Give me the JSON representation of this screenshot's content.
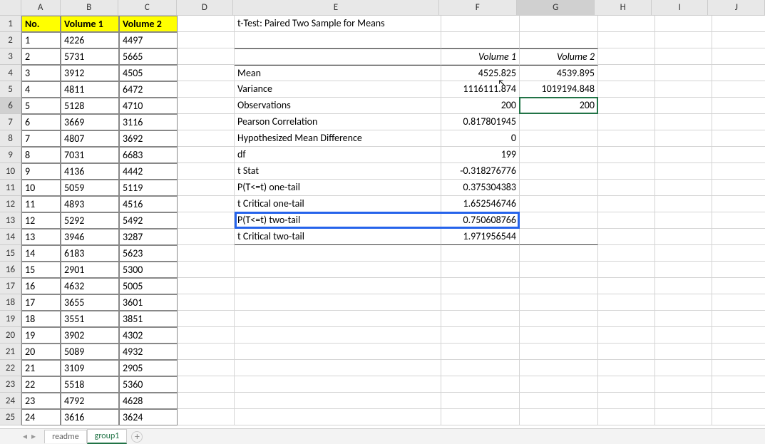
{
  "columns": [
    "A",
    "B",
    "C",
    "D",
    "E",
    "F",
    "G",
    "H",
    "I",
    "J"
  ],
  "selected_col": "G",
  "selected_row": 6,
  "data_headers": {
    "no": "No.",
    "v1": "Volume 1",
    "v2": "Volume 2"
  },
  "data_rows": [
    {
      "n": "1",
      "v1": "4226",
      "v2": "4497"
    },
    {
      "n": "2",
      "v1": "5731",
      "v2": "5665"
    },
    {
      "n": "3",
      "v1": "3912",
      "v2": "4505"
    },
    {
      "n": "4",
      "v1": "4811",
      "v2": "6472"
    },
    {
      "n": "5",
      "v1": "5128",
      "v2": "4710"
    },
    {
      "n": "6",
      "v1": "3669",
      "v2": "3116"
    },
    {
      "n": "7",
      "v1": "4807",
      "v2": "3692"
    },
    {
      "n": "8",
      "v1": "7031",
      "v2": "6683"
    },
    {
      "n": "9",
      "v1": "4136",
      "v2": "4442"
    },
    {
      "n": "10",
      "v1": "5059",
      "v2": "5119"
    },
    {
      "n": "11",
      "v1": "4893",
      "v2": "4516"
    },
    {
      "n": "12",
      "v1": "5292",
      "v2": "5492"
    },
    {
      "n": "13",
      "v1": "3946",
      "v2": "3287"
    },
    {
      "n": "14",
      "v1": "6183",
      "v2": "5623"
    },
    {
      "n": "15",
      "v1": "2901",
      "v2": "5300"
    },
    {
      "n": "16",
      "v1": "4632",
      "v2": "5005"
    },
    {
      "n": "17",
      "v1": "3655",
      "v2": "3601"
    },
    {
      "n": "18",
      "v1": "3551",
      "v2": "3851"
    },
    {
      "n": "19",
      "v1": "3902",
      "v2": "4302"
    },
    {
      "n": "20",
      "v1": "5089",
      "v2": "4932"
    },
    {
      "n": "21",
      "v1": "3109",
      "v2": "2905"
    },
    {
      "n": "22",
      "v1": "5518",
      "v2": "5360"
    },
    {
      "n": "23",
      "v1": "4792",
      "v2": "4628"
    },
    {
      "n": "24",
      "v1": "3616",
      "v2": "3624"
    }
  ],
  "ttest_title": "t-Test: Paired Two Sample for Means",
  "stat_header_v1": "Volume 1",
  "stat_header_v2": "Volume 2",
  "stats": [
    {
      "label": "Mean",
      "v1": "4525.825",
      "v2": "4539.895"
    },
    {
      "label": "Variance",
      "v1": "1116111.874",
      "v2": "1019194.848"
    },
    {
      "label": "Observations",
      "v1": "200",
      "v2": "200"
    },
    {
      "label": "Pearson Correlation",
      "v1": "0.817801945",
      "v2": ""
    },
    {
      "label": "Hypothesized Mean Difference",
      "v1": "0",
      "v2": ""
    },
    {
      "label": "df",
      "v1": "199",
      "v2": ""
    },
    {
      "label": "t Stat",
      "v1": "-0.318276776",
      "v2": ""
    },
    {
      "label": "P(T<=t) one-tail",
      "v1": "0.375304383",
      "v2": ""
    },
    {
      "label": "t Critical one-tail",
      "v1": "1.652546746",
      "v2": ""
    },
    {
      "label": "P(T<=t) two-tail",
      "v1": "0.750608766",
      "v2": ""
    },
    {
      "label": "t Critical two-tail",
      "v1": "1.971956544",
      "v2": ""
    }
  ],
  "tabs": {
    "readme": "readme",
    "group1": "group1"
  },
  "chart_data": {
    "type": "table",
    "title": "t-Test: Paired Two Sample for Means",
    "columns": [
      "Volume 1",
      "Volume 2"
    ],
    "rows": {
      "Mean": [
        4525.825,
        4539.895
      ],
      "Variance": [
        1116111.874,
        1019194.848
      ],
      "Observations": [
        200,
        200
      ],
      "Pearson Correlation": [
        0.817801945,
        null
      ],
      "Hypothesized Mean Difference": [
        0,
        null
      ],
      "df": [
        199,
        null
      ],
      "t Stat": [
        -0.318276776,
        null
      ],
      "P(T<=t) one-tail": [
        0.375304383,
        null
      ],
      "t Critical one-tail": [
        1.652546746,
        null
      ],
      "P(T<=t) two-tail": [
        0.750608766,
        null
      ],
      "t Critical two-tail": [
        1.971956544,
        null
      ]
    }
  }
}
